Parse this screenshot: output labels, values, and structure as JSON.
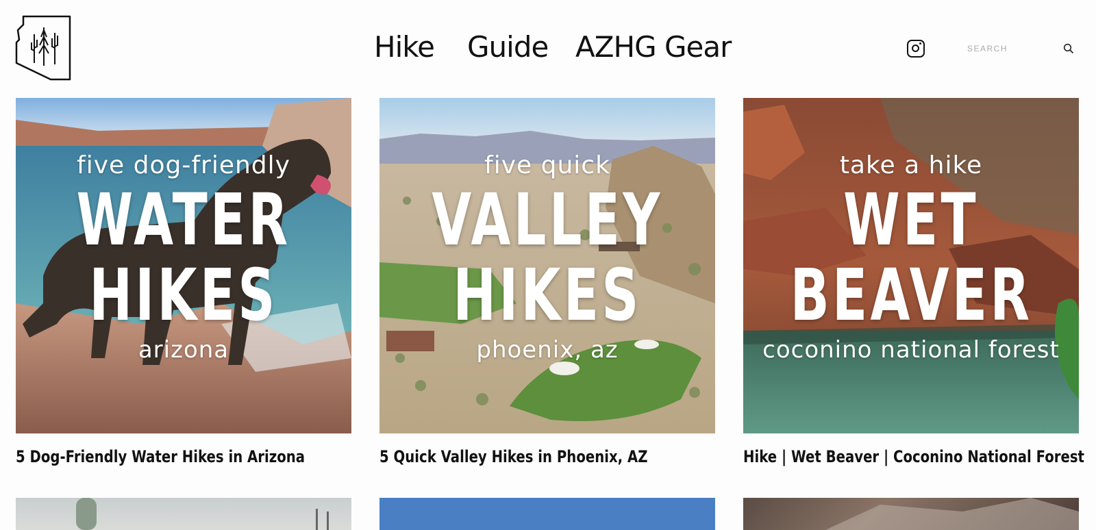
{
  "header": {
    "logo_alt": "Arizona Hiking Guide logo",
    "nav": [
      "Hike",
      "Guide",
      "AZHG Gear"
    ],
    "search_placeholder": "SEARCH"
  },
  "posts": [
    {
      "overlay_top": "five dog-friendly",
      "overlay_line1": "WATER",
      "overlay_line2": "HIKES",
      "overlay_bottom": "arizona",
      "title": "5 Dog-Friendly Water Hikes in Arizona"
    },
    {
      "overlay_top": "five quick",
      "overlay_line1": "VALLEY",
      "overlay_line2": "HIKES",
      "overlay_bottom": "phoenix, az",
      "title": "5 Quick Valley Hikes in Phoenix, AZ"
    },
    {
      "overlay_top": "take a hike",
      "overlay_line1": "WET",
      "overlay_line2": "BEAVER",
      "overlay_bottom": "coconino national forest",
      "title": "Hike | Wet Beaver | Coconino National Forest"
    }
  ],
  "icons": {
    "instagram": "instagram-icon",
    "search": "search-icon"
  }
}
